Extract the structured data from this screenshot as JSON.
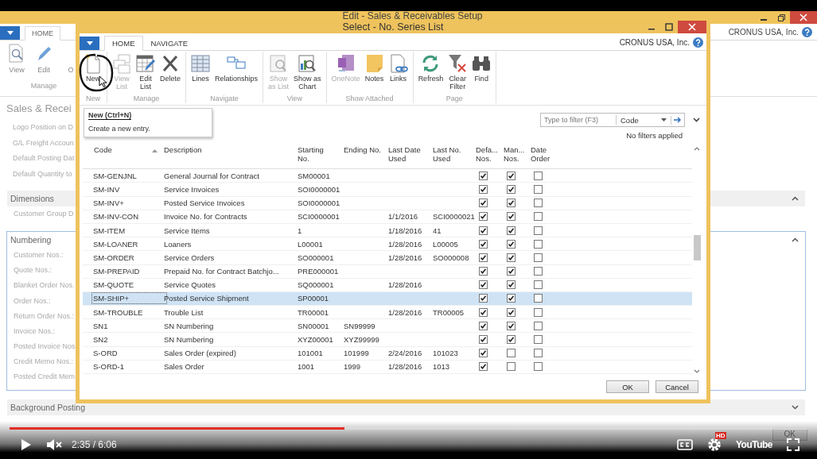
{
  "background_window": {
    "title": "Edit - Sales & Receivables Setup",
    "company": "CRONUS USA, Inc.",
    "tabs": [
      {
        "label": "HOME",
        "selected": true
      }
    ],
    "actions": [
      {
        "kind": "view",
        "label": "View"
      },
      {
        "kind": "edit",
        "label": "Edit"
      },
      {
        "kind": "other",
        "label": "O"
      }
    ],
    "group": "Manage",
    "page_title": "Sales & Recei",
    "fields": [
      "Logo Position on D",
      "G/L Freight Accoun",
      "Default Posting Dat",
      "Default Quantity to"
    ],
    "sections": [
      {
        "title": "Dimensions",
        "expanded": true,
        "focused": false,
        "fields": [
          "Customer Group D"
        ]
      },
      {
        "title": "Numbering",
        "expanded": true,
        "focused": true,
        "fields": [
          "Customer Nos.:",
          "Quote Nos.:",
          "Blanket Order Nos.",
          "Order Nos.:",
          "Return Order Nos.:",
          "Invoice Nos.:",
          "Posted Invoice Nos",
          "Credit Memo Nos.:",
          "Posted Credit Mem"
        ]
      },
      {
        "title": "Background Posting",
        "expanded": false,
        "focused": false
      }
    ],
    "ok_button": "OK"
  },
  "dialog": {
    "title": "Select - No. Series List",
    "company": "CRONUS USA, Inc.",
    "tabs": [
      {
        "label": "HOME",
        "selected": true
      },
      {
        "label": "NAVIGATE",
        "selected": false
      }
    ],
    "ribbon_groups": [
      {
        "label": "New",
        "actions": [
          {
            "kind": "new",
            "label": "New",
            "disabled": false
          }
        ]
      },
      {
        "label": "Manage",
        "actions": [
          {
            "kind": "view-list",
            "label": "View\nList",
            "disabled": true
          },
          {
            "kind": "edit-list",
            "label": "Edit\nList",
            "disabled": false
          },
          {
            "kind": "delete",
            "label": "Delete",
            "disabled": false
          }
        ]
      },
      {
        "label": "Navigate",
        "actions": [
          {
            "kind": "lines",
            "label": "Lines",
            "disabled": false
          },
          {
            "kind": "relationships",
            "label": "Relationships",
            "disabled": false
          }
        ]
      },
      {
        "label": "View",
        "actions": [
          {
            "kind": "show-list",
            "label": "Show\nas List",
            "disabled": true
          },
          {
            "kind": "chart",
            "label": "Show as\nChart",
            "disabled": false
          }
        ]
      },
      {
        "label": "Show Attached",
        "actions": [
          {
            "kind": "onenote",
            "label": "OneNote",
            "disabled": true
          },
          {
            "kind": "notes",
            "label": "Notes",
            "disabled": false
          },
          {
            "kind": "links",
            "label": "Links",
            "disabled": false
          }
        ]
      },
      {
        "label": "Page",
        "actions": [
          {
            "kind": "refresh",
            "label": "Refresh",
            "disabled": false
          },
          {
            "kind": "clear-filter",
            "label": "Clear\nFilter",
            "disabled": false
          },
          {
            "kind": "find",
            "label": "Find",
            "disabled": false
          }
        ]
      }
    ],
    "tooltip": {
      "title": "New (Ctrl+N)",
      "text": "Create a new entry."
    },
    "filter": {
      "placeholder": "Type to filter (F3)",
      "field": "Code",
      "status": "No filters applied"
    },
    "table": {
      "columns": [
        "Code",
        "Description",
        "Starting\nNo.",
        "Ending No.",
        "Last Date\nUsed",
        "Last No.\nUsed",
        "Defa...\nNos.",
        "Man...\nNos.",
        "Date\nOrder"
      ],
      "rows": [
        {
          "code": "SM-GENJNL",
          "description": "General Journal for Contract",
          "starting_no": "SM00001",
          "default_nos": true,
          "manual_nos": true,
          "date_order": false,
          "selected": false
        },
        {
          "code": "SM-INV",
          "description": "Service Invoices",
          "starting_no": "SOI0000001",
          "default_nos": true,
          "manual_nos": true,
          "date_order": false,
          "selected": false
        },
        {
          "code": "SM-INV+",
          "description": "Posted Service Invoices",
          "starting_no": "SOI0000001",
          "default_nos": true,
          "manual_nos": true,
          "date_order": false,
          "selected": false
        },
        {
          "code": "SM-INV-CON",
          "description": "Invoice No. for Contracts",
          "starting_no": "SCI0000001",
          "last_date_used": "1/1/2016",
          "last_no_used": "SCI0000021",
          "default_nos": true,
          "manual_nos": true,
          "date_order": false,
          "selected": false
        },
        {
          "code": "SM-ITEM",
          "description": "Service Items",
          "starting_no": "1",
          "last_date_used": "1/18/2016",
          "last_no_used": "41",
          "default_nos": true,
          "manual_nos": true,
          "date_order": false,
          "selected": false
        },
        {
          "code": "SM-LOANER",
          "description": "Loaners",
          "starting_no": "L00001",
          "last_date_used": "1/28/2016",
          "last_no_used": "L00005",
          "default_nos": true,
          "manual_nos": true,
          "date_order": false,
          "selected": false
        },
        {
          "code": "SM-ORDER",
          "description": "Service Orders",
          "starting_no": "SO000001",
          "last_date_used": "1/28/2016",
          "last_no_used": "SO000008",
          "default_nos": true,
          "manual_nos": true,
          "date_order": false,
          "selected": false
        },
        {
          "code": "SM-PREPAID",
          "description": "Prepaid No. for Contract Batchjo...",
          "starting_no": "PRE000001",
          "default_nos": true,
          "manual_nos": true,
          "date_order": false,
          "selected": false
        },
        {
          "code": "SM-QUOTE",
          "description": "Service Quotes",
          "starting_no": "SQ000001",
          "last_date_used": "1/28/2016",
          "default_nos": true,
          "manual_nos": true,
          "date_order": false,
          "selected": false
        },
        {
          "code": "SM-SHIP+",
          "description": "Posted Service Shipment",
          "starting_no": "SP00001",
          "default_nos": true,
          "manual_nos": true,
          "date_order": false,
          "selected": true
        },
        {
          "code": "SM-TROUBLE",
          "description": "Trouble List",
          "starting_no": "TR00001",
          "last_date_used": "1/28/2016",
          "last_no_used": "TR00005",
          "default_nos": true,
          "manual_nos": true,
          "date_order": false,
          "selected": false
        },
        {
          "code": "SN1",
          "description": "SN Numbering",
          "starting_no": "SN00001",
          "ending_no": "SN99999",
          "default_nos": true,
          "manual_nos": true,
          "date_order": false,
          "selected": false
        },
        {
          "code": "SN2",
          "description": "SN Numbering",
          "starting_no": "XYZ00001",
          "ending_no": "XYZ99999",
          "default_nos": true,
          "manual_nos": true,
          "date_order": false,
          "selected": false
        },
        {
          "code": "S-ORD",
          "description": "Sales Order (expired)",
          "starting_no": "101001",
          "ending_no": "101999",
          "last_date_used": "2/24/2016",
          "last_no_used": "101023",
          "default_nos": true,
          "manual_nos": false,
          "date_order": false,
          "selected": false
        },
        {
          "code": "S-ORD-1",
          "description": "Sales Order",
          "starting_no": "1001",
          "ending_no": "1999",
          "last_date_used": "1/28/2016",
          "last_no_used": "1013",
          "default_nos": true,
          "manual_nos": false,
          "date_order": false,
          "selected": false
        }
      ]
    },
    "buttons": [
      "OK",
      "Cancel"
    ]
  },
  "video": {
    "progress": {
      "level": 0.42
    },
    "time": "2:35 / 6:06",
    "muted": true,
    "hd_badge": "HD",
    "logo": "YouTube"
  }
}
